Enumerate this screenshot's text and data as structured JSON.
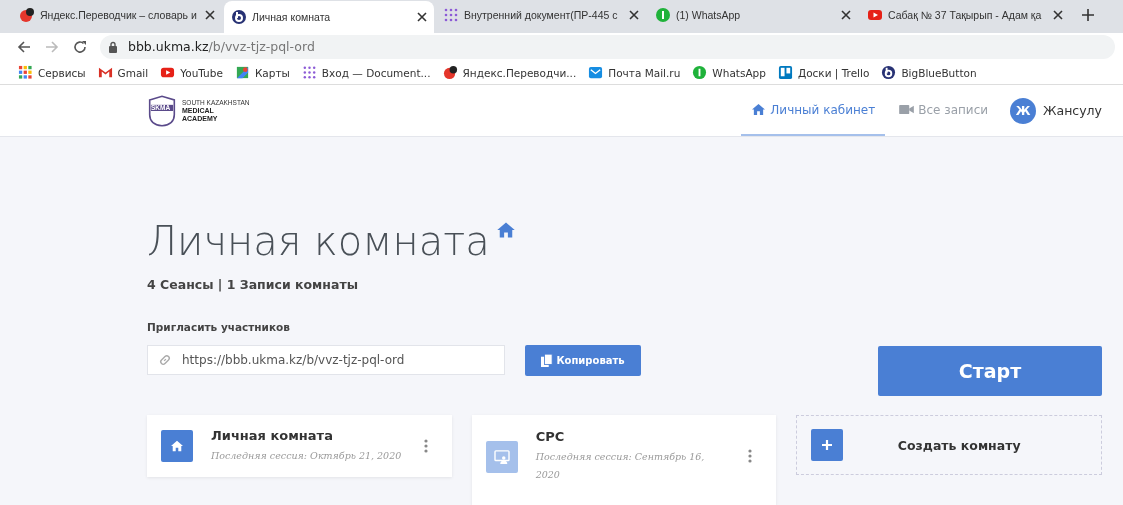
{
  "browser": {
    "tabs": [
      {
        "title": "Яндекс.Переводчик – словарь и",
        "selected": false
      },
      {
        "title": "Личная комната",
        "selected": true
      },
      {
        "title": "Внутренний документ(ПР-445 с",
        "selected": false
      },
      {
        "title": "(1) WhatsApp",
        "selected": false
      },
      {
        "title": "Сабақ № 37 Тақырып - Адам қа",
        "selected": false
      }
    ],
    "address": {
      "host": "bbb.ukma.kz",
      "path": "/b/vvz-tjz-pql-ord"
    },
    "bookmarks": [
      {
        "label": "Сервисы"
      },
      {
        "label": "Gmail"
      },
      {
        "label": "YouTube"
      },
      {
        "label": "Карты"
      },
      {
        "label": "Вход — Document..."
      },
      {
        "label": "Яндекс.Переводчи..."
      },
      {
        "label": "Почта Mail.ru"
      },
      {
        "label": "WhatsApp"
      },
      {
        "label": "Доски | Trello"
      },
      {
        "label": "BigBlueButton"
      }
    ]
  },
  "header": {
    "logo": {
      "emblem": "SKMA",
      "line_1": "SOUTH KAZAKHSTAN",
      "line_2": "MEDICAL",
      "line_3": "ACADEMY"
    },
    "nav": [
      {
        "label": "Личный кабинет",
        "selected": true
      },
      {
        "label": "Все записи",
        "selected": false
      }
    ],
    "user": {
      "initial": "Ж",
      "name": "Жансулу"
    }
  },
  "room": {
    "title": "Личная комната",
    "stats": "4 Сеансы | 1 Записи комнаты",
    "invite_label": "Пригласить участников",
    "invite_url": "https://bbb.ukma.kz/b/vvz-tjz-pql-ord",
    "copy_button": "Копировать",
    "start_button": "Старт"
  },
  "rooms": [
    {
      "kind": "room",
      "name": "Личная комната",
      "last_session": "Последняя сессия: Октябрь 21, 2020",
      "selected": true
    },
    {
      "kind": "room",
      "name": "СРС",
      "last_session": "Последняя сессия: Сентябрь 16, 2020",
      "selected": false
    },
    {
      "kind": "create",
      "name": "Создать комнату"
    }
  ]
}
